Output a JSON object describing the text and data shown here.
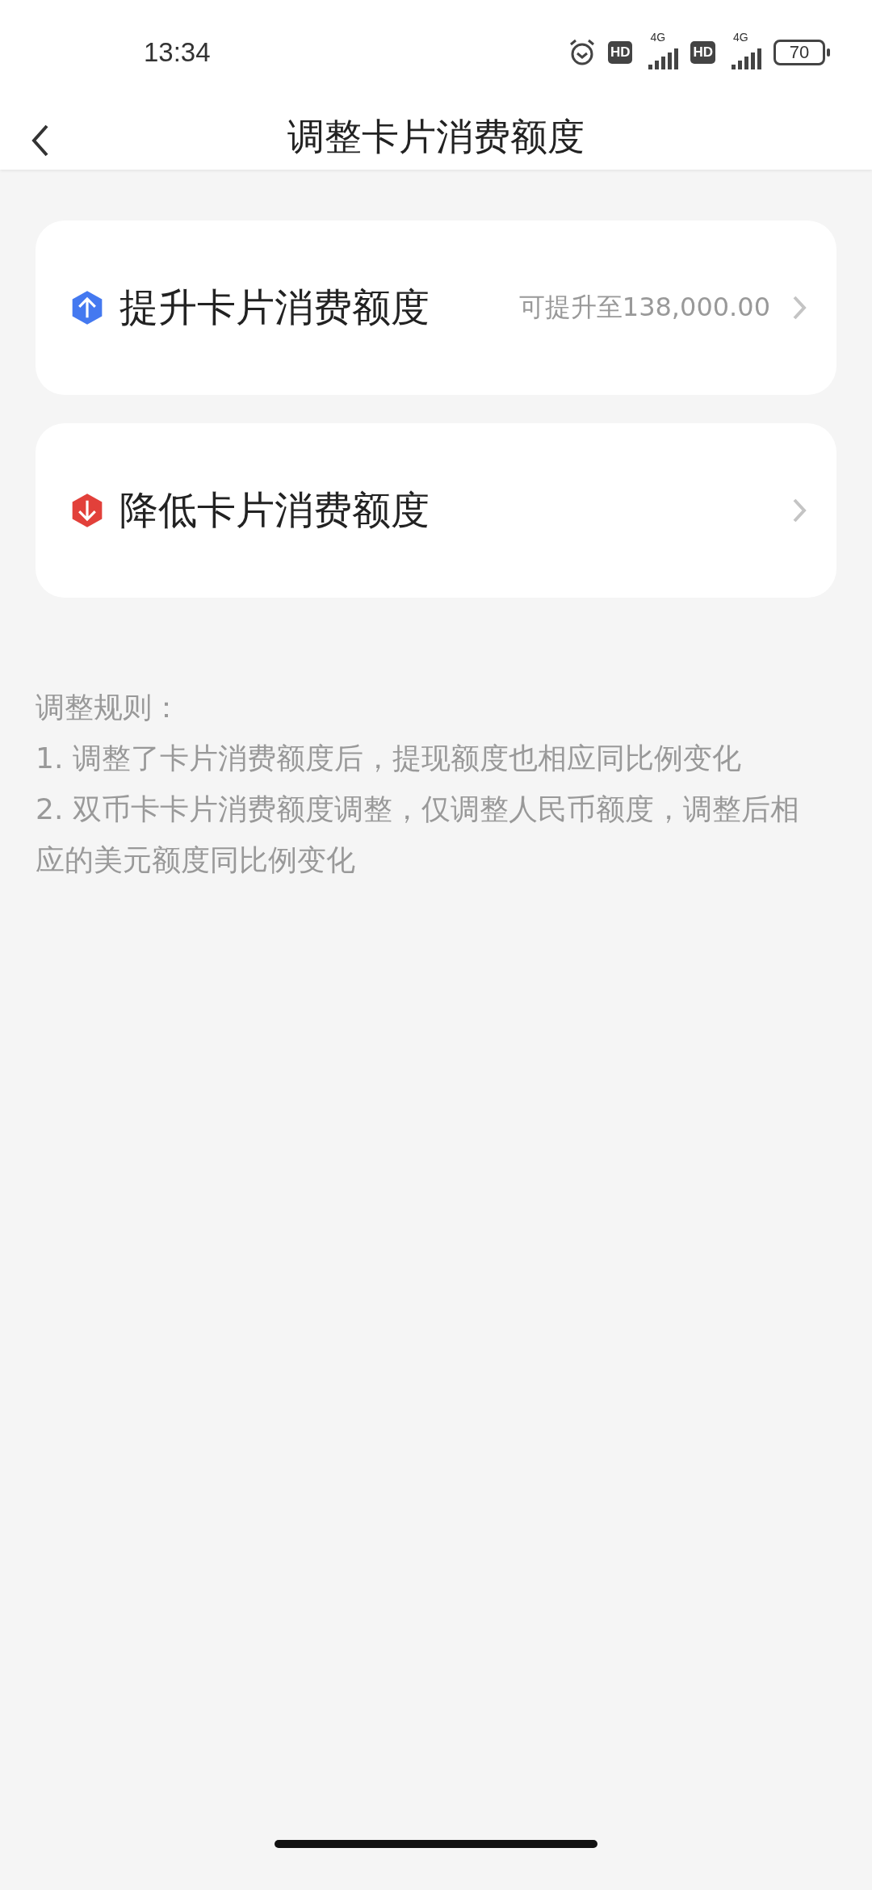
{
  "status_bar": {
    "time": "13:34",
    "sims": [
      {
        "hd": "HD",
        "network": "4G"
      },
      {
        "hd": "HD",
        "network": "4G"
      }
    ],
    "battery": "70"
  },
  "nav": {
    "title": "调整卡片消费额度"
  },
  "options": [
    {
      "kind": "up",
      "color": "#4479f0",
      "label": "提升卡片消费额度",
      "hint": "可提升至138,000.00"
    },
    {
      "kind": "down",
      "color": "#e2403a",
      "label": "降低卡片消费额度"
    }
  ],
  "rules": {
    "title": "调整规则：",
    "items": [
      "1. 调整了卡片消费额度后，提现额度也相应同比例变化",
      "2. 双币卡卡片消费额度调整，仅调整人民币额度，调整后相应的美元额度同比例变化"
    ]
  }
}
